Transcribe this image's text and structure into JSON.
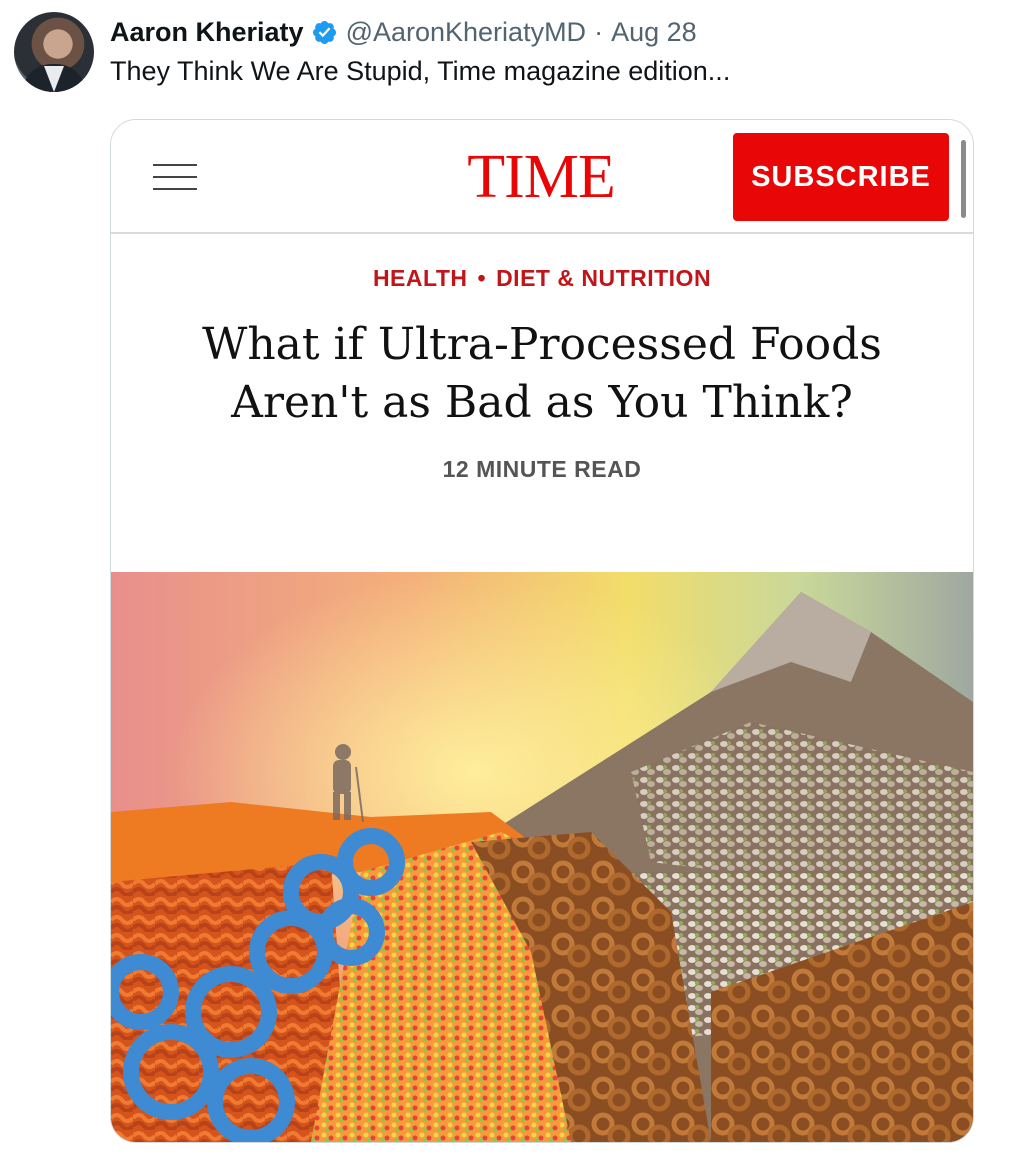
{
  "tweet": {
    "author_name": "Aaron Kheriaty",
    "handle": "@AaronKheriatyMD",
    "separator": "·",
    "date": "Aug 28",
    "text": "They Think We Are Stupid, Time magazine edition..."
  },
  "card": {
    "logo": "TIME",
    "subscribe_label": "SUBSCRIBE",
    "kicker": [
      "HEALTH",
      "DIET & NUTRITION"
    ],
    "kicker_separator": "•",
    "headline_line1": "What if Ultra-Processed Foods",
    "headline_line2": "Aren't as Bad as You Think?",
    "read_time": "12 MINUTE READ"
  },
  "colors": {
    "verified": "#1d9bf0",
    "time_red": "#e90606",
    "kicker_red": "#c0161a",
    "handle_gray": "#536471"
  },
  "icons": [
    "verified-badge-icon",
    "hamburger-menu-icon"
  ]
}
